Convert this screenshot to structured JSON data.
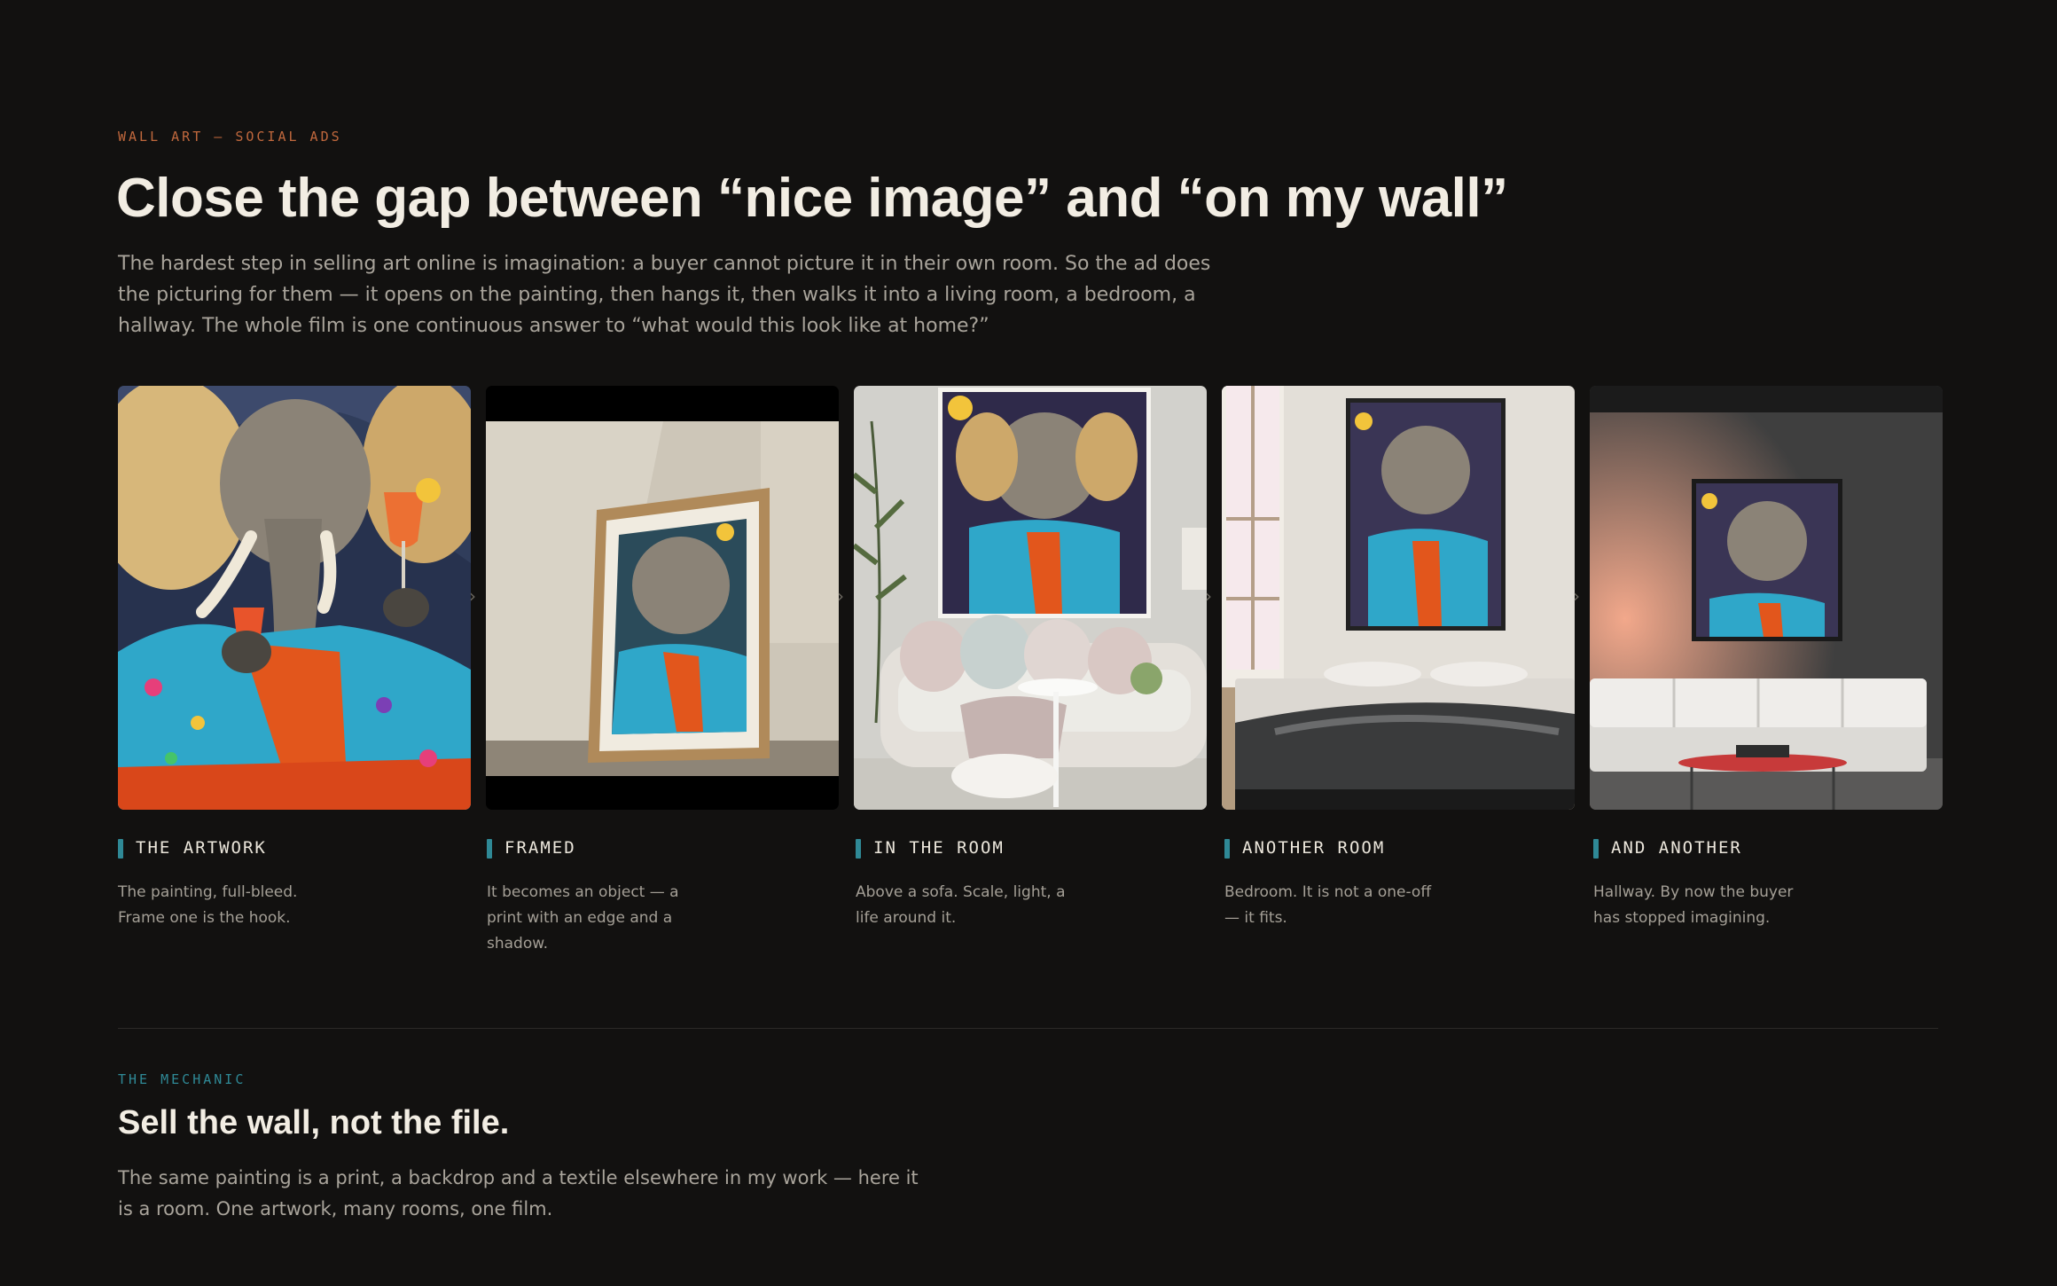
{
  "hero": {
    "eyebrow": "WALL ART – SOCIAL ADS",
    "title": "Close the gap between “nice image” and “on my wall”",
    "lead": "The hardest step in selling art online is imagination: a buyer cannot picture it in their own room. So the ad does the picturing for them — it opens on the painting, then hangs it, then walks it into a living room, a bedroom, a hallway. The whole film is one continuous answer to “what would this look like at home?”"
  },
  "frames": [
    {
      "title": "THE ARTWORK",
      "desc": "The painting, full-bleed. Frame one is the hook."
    },
    {
      "title": "FRAMED",
      "desc": "It becomes an object — a print with an edge and a shadow."
    },
    {
      "title": "IN THE ROOM",
      "desc": "Above a sofa. Scale, light, a life around it."
    },
    {
      "title": "ANOTHER ROOM",
      "desc": "Bedroom. It is not a one-off — it fits."
    },
    {
      "title": "AND ANOTHER",
      "desc": "Hallway. By now the buyer has stopped imagining."
    }
  ],
  "arrow_glyph": "›",
  "mechanic": {
    "eyebrow": "THE MECHANIC",
    "title": "Sell the wall, not the file.",
    "body": "The same painting is a print, a backdrop and a textile elsewhere in my work — here it is a room. One artwork, many rooms, one film."
  },
  "colors": {
    "background": "#121110",
    "accent_orange": "#c0683d",
    "accent_teal": "#2f8996"
  }
}
